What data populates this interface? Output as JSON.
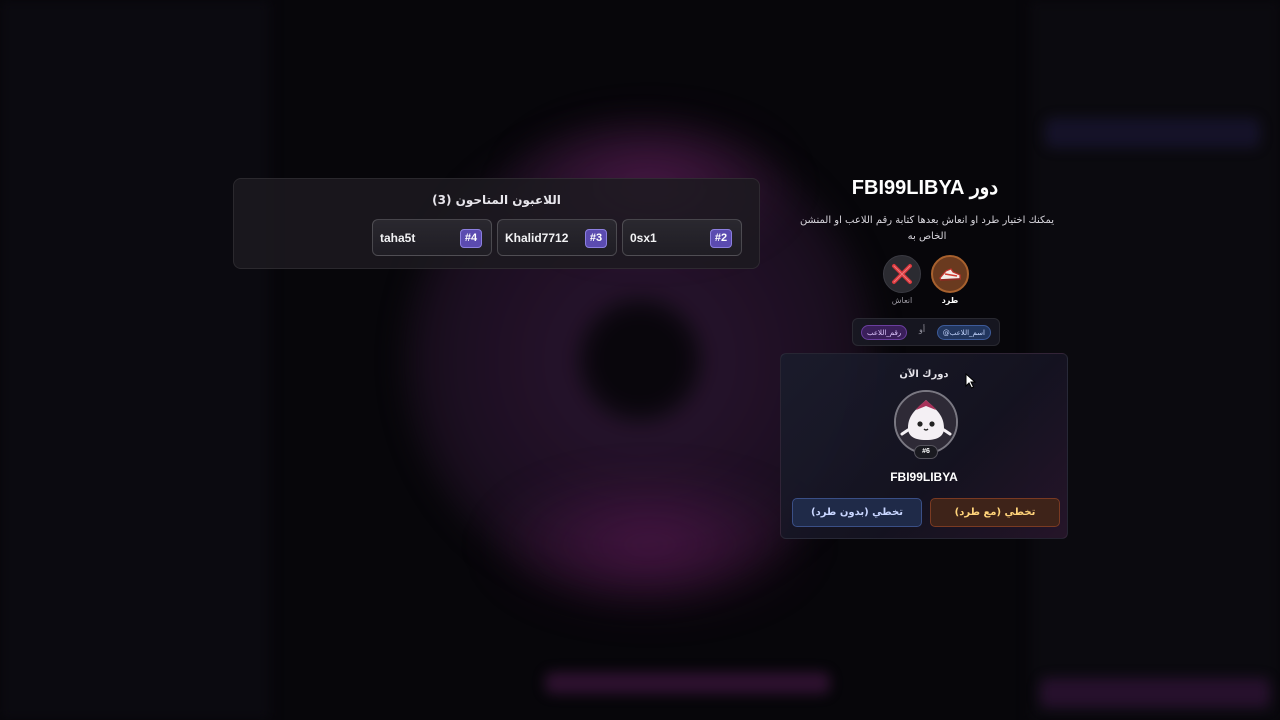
{
  "players_panel": {
    "title": "اللاعبون المتاحون (3)",
    "players": [
      {
        "name": "0sx1",
        "number": "#2"
      },
      {
        "name": "Khalid7712",
        "number": "#3"
      },
      {
        "name": "taha5t",
        "number": "#4"
      }
    ]
  },
  "turn": {
    "title": "دور FBI99LIBYA",
    "description": "يمكنك اختيار طرد او انعاش بعدها كتابة رقم اللاعب او المنشن الخاص به",
    "actions": {
      "kick_label": "طرد",
      "kick_icon": "sneaker-kick-icon",
      "revive_label": "انعاش",
      "revive_icon": "cross-revive-icon"
    },
    "hint": {
      "by_name": "@اسم_اللاعب",
      "or": "أو",
      "by_number": "رقم_اللاعب"
    }
  },
  "current": {
    "label": "دورك الآن",
    "avatar_icon": "ghost-avatar-icon",
    "badge": "#6",
    "name": "FBI99LIBYA",
    "skip_with_kick": "تخطي (مع طرد)",
    "skip_without_kick": "تخطي (بدون طرد)"
  },
  "colors": {
    "accent_purple": "#5b4bb0",
    "kick_orange": "#a8612e",
    "skip_kick_text": "#ffd37a",
    "skip_nokick_bg": "#1f2a48"
  }
}
